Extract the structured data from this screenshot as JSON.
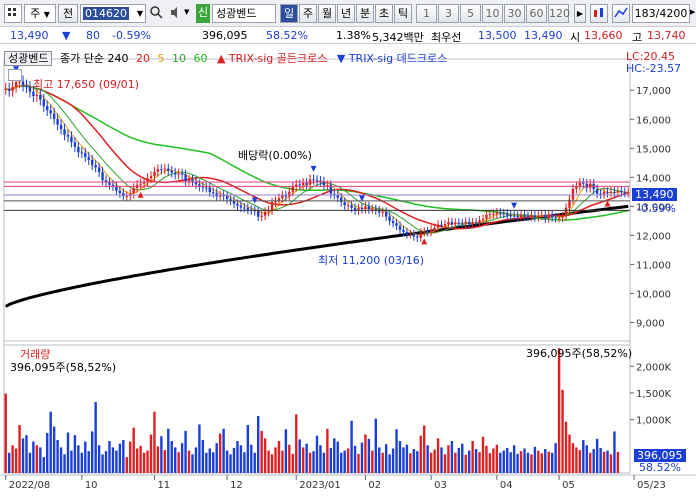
{
  "toolbar": {
    "menu_icon": "grid-menu-icon",
    "market_select": "주",
    "prev_label": "전",
    "code": "014620",
    "name_badge": "신",
    "name": "성광벤드",
    "periods": [
      "일",
      "주",
      "월",
      "년",
      "분",
      "초",
      "틱"
    ],
    "active_period": "일",
    "intervals": [
      "1",
      "3",
      "5",
      "10",
      "30",
      "60",
      "120"
    ],
    "count_display": "183/4200"
  },
  "quote": {
    "price": "13,490",
    "change": "80",
    "change_pct": "-0.59%",
    "volume": "396,095",
    "volume_ratio": "58.52%",
    "turnover_ratio": "1.38%",
    "amount": "5,342백만",
    "bid_ask_label": "최우선",
    "best_ask": "13,500",
    "best_bid": "13,490",
    "open_label": "시",
    "open": "13,660",
    "high_label": "고",
    "high": "13,740"
  },
  "chart_legend": {
    "title": "성광벤드",
    "ma_label": "종가 단순 240",
    "ma_periods": [
      "20",
      "5",
      "10",
      "60"
    ],
    "golden_cross": "TRIX-sig 골든크로스",
    "dead_cross": "TRIX-sig 데드크로스",
    "lc": "LC:20.45",
    "hc": "HC:-23.57"
  },
  "annotations": {
    "high_note": "최고 17,650 (09/01)",
    "dividend_note": "배당락(0.00%)",
    "low_note": "최저 11,200 (03/16)",
    "price_tag": "13,490",
    "pct_tag": "-0.59%",
    "volume_title": "거래량",
    "volume_left": "396,095주(58,52%)",
    "volume_right": "396,095주(58,52%)",
    "volume_tag": "396,095",
    "volume_pct_tag": "58.52%"
  },
  "colors": {
    "up": "#e02020",
    "down": "#1a3fd6",
    "ma5": "#e8a000",
    "ma10": "#2da02d",
    "ma20": "#e02020",
    "ma60": "#20c020",
    "ma240": "#000000"
  },
  "chart_data": {
    "type": "candlestick",
    "price_axis": [
      "17,000",
      "16,000",
      "15,000",
      "14,000",
      "13,000",
      "12,000",
      "11,000",
      "10,000",
      "9,000"
    ],
    "price_ylim": [
      8500,
      17800
    ],
    "volume_axis": [
      "2,000K",
      "1,500K",
      "1,000K"
    ],
    "volume_ylim": [
      0,
      2400000
    ],
    "x_ticks": [
      "2022/08",
      "10",
      "11",
      "12",
      "2023/01",
      "02",
      "03",
      "04",
      "05",
      "05/23"
    ],
    "closes": [
      17050,
      16980,
      17120,
      17280,
      17300,
      17160,
      17110,
      16950,
      16800,
      16840,
      16680,
      16450,
      16310,
      16200,
      16010,
      15810,
      15660,
      15460,
      15400,
      15210,
      15050,
      14860,
      14840,
      14700,
      14600,
      14420,
      14340,
      14180,
      13900,
      13820,
      13740,
      13700,
      13540,
      13460,
      13350,
      13360,
      13440,
      13630,
      13740,
      13780,
      13840,
      13970,
      14040,
      14190,
      14280,
      14270,
      14300,
      14220,
      14160,
      14100,
      14130,
      14100,
      13870,
      13920,
      13850,
      13760,
      13680,
      13650,
      13640,
      13490,
      13460,
      13340,
      13390,
      13350,
      13250,
      13200,
      13090,
      13030,
      12960,
      12950,
      12890,
      12870,
      12840,
      12640,
      12680,
      12810,
      12870,
      13140,
      13180,
      13280,
      13380,
      13340,
      13500,
      13670,
      13750,
      13730,
      13810,
      13750,
      13930,
      13910,
      13880,
      13860,
      13720,
      13730,
      13430,
      13400,
      13300,
      13150,
      13040,
      13040,
      12950,
      12860,
      12940,
      12910,
      13000,
      12900,
      12900,
      12860,
      12790,
      12810,
      12650,
      12500,
      12420,
      12330,
      12190,
      12120,
      12040,
      12040,
      11960,
      11920,
      12100,
      12140,
      12110,
      12210,
      12260,
      12370,
      12340,
      12390,
      12460,
      12380,
      12440,
      12430,
      12420,
      12470,
      12390,
      12450,
      12430,
      12520,
      12570,
      12710,
      12730,
      12740,
      12790,
      12760,
      12750,
      12690,
      12680,
      12670,
      12630,
      12700,
      12670,
      12640,
      12690,
      12620,
      12680,
      12700,
      12580,
      12700,
      12620,
      12600,
      12610,
      12660,
      12950,
      13230,
      13600,
      13700,
      13810,
      13780,
      13640,
      13780,
      13590,
      13440,
      13420,
      13490,
      13470,
      13500,
      13490,
      13520,
      13490,
      13470,
      13490
    ],
    "volumes": [
      1490000,
      380000,
      520000,
      460000,
      900000,
      650000,
      710000,
      380000,
      590000,
      520000,
      480000,
      300000,
      750000,
      1150000,
      870000,
      620000,
      480000,
      350000,
      760000,
      420000,
      710000,
      520000,
      380000,
      590000,
      410000,
      780000,
      1330000,
      520000,
      350000,
      410000,
      600000,
      480000,
      420000,
      550000,
      620000,
      300000,
      590000,
      850000,
      460000,
      510000,
      380000,
      420000,
      720000,
      1150000,
      500000,
      690000,
      430000,
      830000,
      600000,
      480000,
      390000,
      560000,
      790000,
      420000,
      350000,
      480000,
      910000,
      620000,
      380000,
      460000,
      390000,
      560000,
      740000,
      830000,
      420000,
      350000,
      470000,
      600000,
      520000,
      390000,
      900000,
      530000,
      380000,
      1070000,
      790000,
      650000,
      420000,
      350000,
      480000,
      600000,
      420000,
      820000,
      530000,
      360000,
      1100000,
      630000,
      480000,
      550000,
      380000,
      410000,
      700000,
      520000,
      380000,
      830000,
      470000,
      650000,
      590000,
      380000,
      420000,
      460000,
      980000,
      510000,
      360000,
      570000,
      720000,
      640000,
      420000,
      1020000,
      480000,
      380000,
      540000,
      350000,
      460000,
      820000,
      600000,
      480000,
      530000,
      370000,
      450000,
      410000,
      700000,
      890000,
      520000,
      380000,
      440000,
      650000,
      480000,
      350000,
      520000,
      600000,
      380000,
      470000,
      550000,
      340000,
      420000,
      600000,
      450000,
      390000,
      680000,
      510000,
      370000,
      460000,
      530000,
      380000,
      420000,
      470000,
      390000,
      520000,
      360000,
      410000,
      460000,
      380000,
      350000,
      490000,
      420000,
      370000,
      450000,
      400000,
      380000,
      560000,
      2340000,
      1560000,
      960000,
      720000,
      560000,
      480000,
      430000,
      620000,
      520000,
      380000,
      450000,
      640000,
      470000,
      396095,
      420000,
      350000,
      780000,
      396095
    ],
    "series": [
      {
        "name": "20"
      },
      {
        "name": "5"
      },
      {
        "name": "10"
      },
      {
        "name": "60"
      },
      {
        "name": "종가 단순 240"
      }
    ]
  }
}
